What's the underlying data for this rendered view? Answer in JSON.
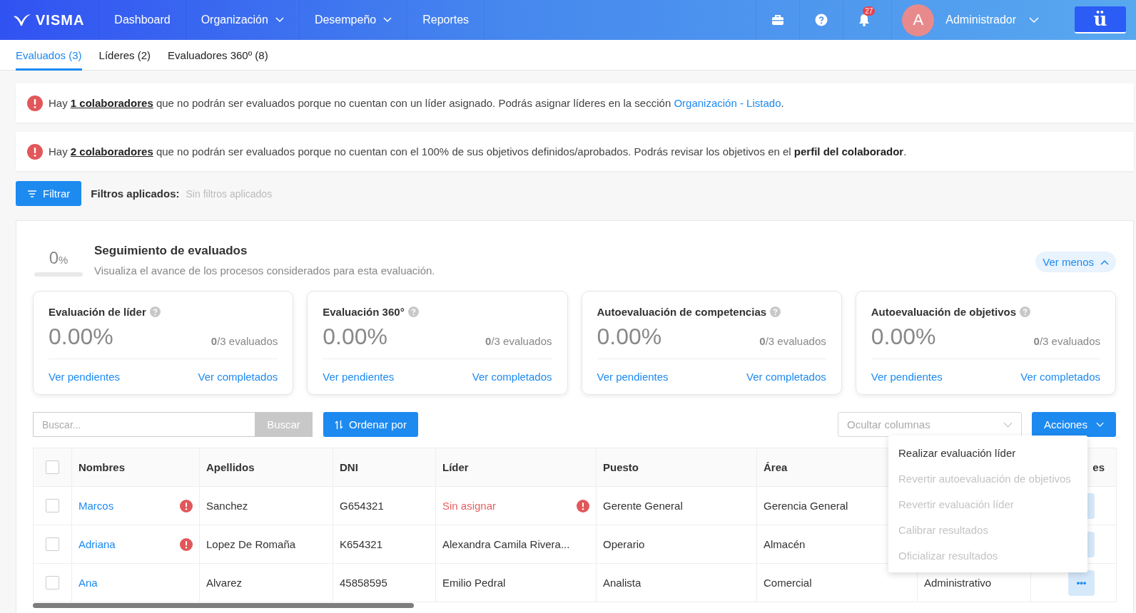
{
  "navbar": {
    "logo": "VISMA",
    "items": [
      {
        "label": "Dashboard",
        "has_menu": false
      },
      {
        "label": "Organización",
        "has_menu": true
      },
      {
        "label": "Desempeño",
        "has_menu": true
      },
      {
        "label": "Reportes",
        "has_menu": false
      }
    ],
    "notifications": "27",
    "avatar": "A",
    "user": "Administrador",
    "brand_button": "ü"
  },
  "tabs": [
    {
      "label": "Evaluados (3)",
      "selected": true
    },
    {
      "label": "Líderes (2)",
      "selected": false
    },
    {
      "label": "Evaluadores 360º (8)",
      "selected": false
    }
  ],
  "alerts": [
    {
      "segments": [
        {
          "kind": "text",
          "text": "Hay "
        },
        {
          "kind": "underline",
          "text": "1 colaboradores"
        },
        {
          "kind": "text",
          "text": " que no podrán ser evaluados porque no cuentan con un líder asignado. Podrás asignar líderes en la sección "
        },
        {
          "kind": "link",
          "text": "Organización - Listado"
        },
        {
          "kind": "text",
          "text": "."
        }
      ]
    },
    {
      "segments": [
        {
          "kind": "text",
          "text": "Hay "
        },
        {
          "kind": "underline",
          "text": "2 colaboradores"
        },
        {
          "kind": "text",
          "text": " que no podrán ser evaluados porque no cuentan con el 100% de sus objetivos definidos/aprobados. Podrás revisar los objetivos en el "
        },
        {
          "kind": "bold",
          "text": "perfil del colaborador"
        },
        {
          "kind": "text",
          "text": "."
        }
      ]
    }
  ],
  "filter": {
    "button": "Filtrar",
    "label": "Filtros aplicados:",
    "value": "Sin filtros aplicados"
  },
  "tracking": {
    "percent": "0",
    "unit": "%",
    "level": 0,
    "title": "Seguimiento de evaluados",
    "subtitle": "Visualiza el avance de los procesos considerados para esta evaluación.",
    "toggle": "Ver menos"
  },
  "cards": [
    {
      "title": "Evaluación de líder",
      "value": "0.00%",
      "count": "**0**/3 evaluados",
      "pending": "Ver pendientes",
      "completed": "Ver completados"
    },
    {
      "title": "Evaluación 360°",
      "value": "0.00%",
      "count": "**0**/3 evaluados",
      "pending": "Ver pendientes",
      "completed": "Ver completados"
    },
    {
      "title": "Autoevaluación de competencias",
      "value": "0.00%",
      "count": "**0**/3 evaluados",
      "pending": "Ver pendientes",
      "completed": "Ver completados"
    },
    {
      "title": "Autoevaluación de objetivos",
      "value": "0.00%",
      "count": "**0**/3 evaluados",
      "pending": "Ver pendientes",
      "completed": "Ver completados"
    }
  ],
  "toolbar": {
    "search_placeholder": "Buscar...",
    "search_button": "Buscar",
    "sort_button": "Ordenar por",
    "columns_placeholder": "Ocultar columnas",
    "actions_button": "Acciones"
  },
  "actions_menu": [
    {
      "label": "Realizar evaluación líder",
      "disabled": false
    },
    {
      "label": "Revertir autoevaluación de objetivos",
      "disabled": true
    },
    {
      "label": "Revertir evaluación líder",
      "disabled": true
    },
    {
      "label": "Calibrar resultados",
      "disabled": true
    },
    {
      "label": "Oficializar resultados",
      "disabled": true
    }
  ],
  "table": {
    "select_all_checked": false,
    "columns": [
      "Nombres",
      "Apellidos",
      "DNI",
      "Líder",
      "Puesto",
      "Área"
    ],
    "actions_header": "es",
    "rows": [
      {
        "checked": false,
        "name": "Marcos",
        "warning": true,
        "surname": "Sanchez",
        "dni": "G654321",
        "leader": "Sin asignar",
        "leader_missing": true,
        "position": "Gerente General",
        "area": "Gerencia General"
      },
      {
        "checked": false,
        "name": "Adriana",
        "warning": true,
        "surname": "Lopez De Romaña",
        "dni": "K654321",
        "leader": "Alexandra Camila Rivera...",
        "leader_missing": false,
        "position": "Operario",
        "area": "Almacén"
      },
      {
        "checked": false,
        "name": "Ana",
        "warning": false,
        "surname": "Alvarez",
        "dni": "45858595",
        "leader": "Emilio Pedral",
        "leader_missing": false,
        "position": "Analista",
        "area": "Comercial",
        "column_7": "Administrativo",
        "action": "•••"
      }
    ]
  }
}
